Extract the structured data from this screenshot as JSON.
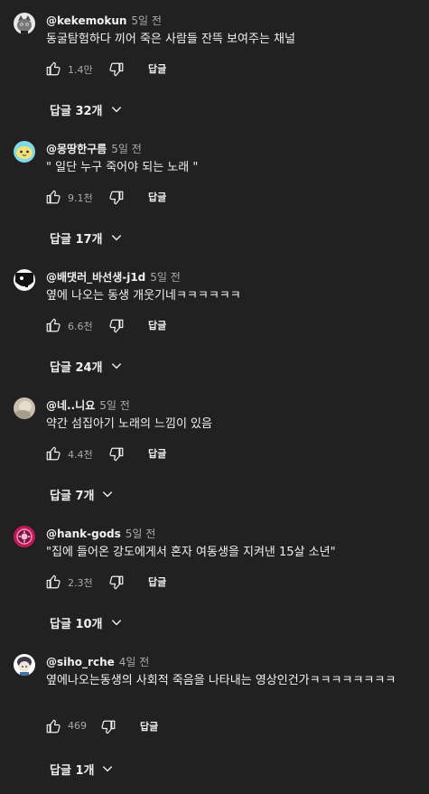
{
  "comments": [
    {
      "author": "@kekemokun",
      "time": "5일 전",
      "text": "동굴탐험하다 끼어 죽은 사람들 잔뜩 보여주는 채널",
      "likes": "1.4만",
      "reply_label": "답글",
      "replies_label": "답글 32개",
      "avatar_icon": "gray-cat-avatar-icon"
    },
    {
      "author": "@몽땅한구름",
      "time": "5일 전",
      "text": "\" 일단 누구 죽어야 되는 노래 \"",
      "likes": "9.1천",
      "reply_label": "답글",
      "replies_label": "답글 17개",
      "avatar_icon": "cyan-yellow-blob-avatar-icon"
    },
    {
      "author": "@배댓러_바선생-j1d",
      "time": "5일 전",
      "text": "옆에 나오는 동생 개웃기네ㅋㅋㅋㅋㅋㅋ",
      "likes": "6.6천",
      "reply_label": "답글",
      "replies_label": "답글 24개",
      "avatar_icon": "black-white-face-avatar-icon"
    },
    {
      "author": "@네..니요",
      "time": "5일 전",
      "text": "약간 섬집아기 노래의 느낌이 있음",
      "likes": "4.4천",
      "reply_label": "답글",
      "replies_label": "답글 7개",
      "avatar_icon": "beige-photo-avatar-icon"
    },
    {
      "author": "@hank-gods",
      "time": "5일 전",
      "text": "\"집에 들어온 강도에게서 혼자 여동생을 지켜낸 15살 소년\"",
      "likes": "2.3천",
      "reply_label": "답글",
      "replies_label": "답글 10개",
      "avatar_icon": "pink-badge-avatar-icon"
    },
    {
      "author": "@siho_rche",
      "time": "4일 전",
      "text": "옆에나오는동생의 사회적 죽음을 나타내는 영상인건가ㅋㅋㅋㅋㅋㅋㅋㅋ",
      "likes": "469",
      "reply_label": "답글",
      "replies_label": "답글 1개",
      "avatar_icon": "white-character-avatar-icon"
    }
  ],
  "colors": {
    "background": "#212121",
    "text_primary": "#f1f1f1",
    "text_secondary": "#aaaaaa"
  }
}
